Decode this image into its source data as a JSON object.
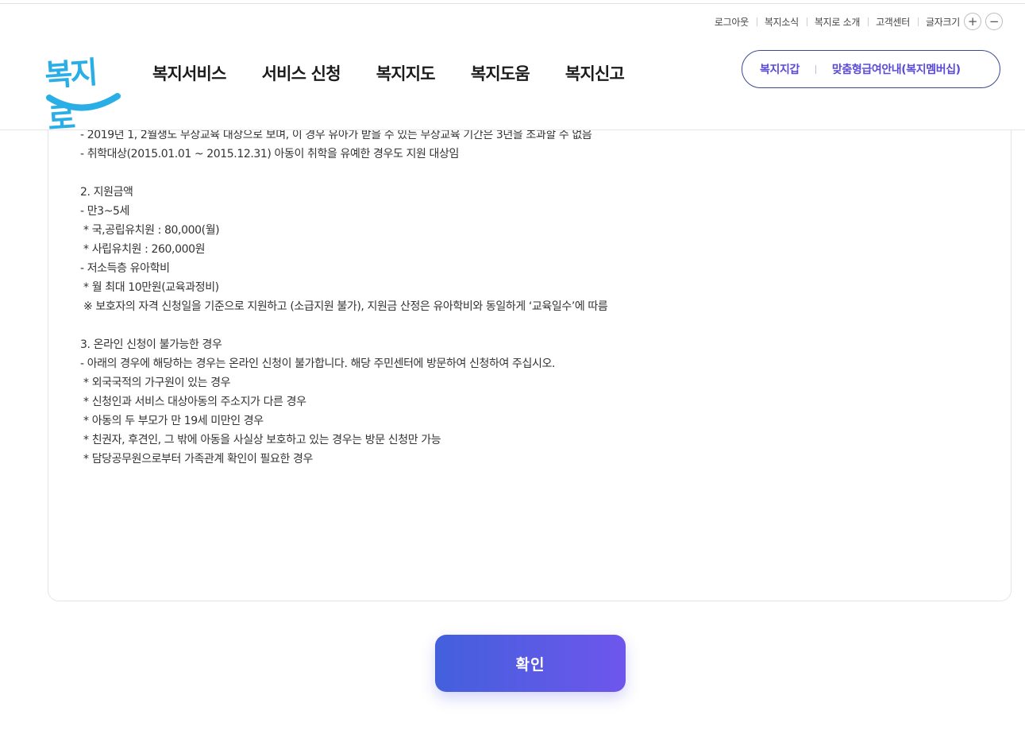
{
  "header": {
    "util_links": [
      "로그아웃",
      "복지소식",
      "복지로 소개",
      "고객센터"
    ],
    "font_size_label": "글자크기",
    "font_increase": "+",
    "font_decrease": "−",
    "logo_text": "복지로",
    "gnb": [
      "복지서비스",
      "서비스 신청",
      "복지지도",
      "복지도움",
      "복지신고"
    ],
    "quick_links": [
      "복지지갑",
      "맞춤형급여안내(복지멤버십)"
    ]
  },
  "content": {
    "lines": [
      "- 2019년 1, 2월생도 무상교육 대상으로 보며, 이 경우 유아가 받을 수 있는 무상교육 기간은 3년을 초과할 수 없음",
      "- 취학대상(2015.01.01 ~ 2015.12.31) 아동이 취학을 유예한 경우도 지원 대상임",
      "",
      "2. 지원금액",
      "- 만3~5세",
      " * 국,공립유치원 : 80,000(월)",
      " * 사립유치원 : 260,000원",
      "- 저소득층 유아학비",
      " * 월 최대 10만원(교육과정비)",
      " ※ 보호자의 자격 신청일을 기준으로 지원하고 (소급지원 불가), 지원금 산정은 유아학비와 동일하게 ‘교육일수’에 따름",
      "",
      "3. 온라인 신청이 불가능한 경우",
      "- 아래의 경우에 해당하는 경우는 온라인 신청이 불가합니다. 해당 주민센터에 방문하여 신청하여 주십시오.",
      " * 외국국적의 가구원이 있는 경우",
      " * 신청인과 서비스 대상아동의 주소지가 다른 경우",
      " * 아동의 두 부모가 만 19세 미만인 경우",
      " * 친권자, 후견인, 그 밖에 아동을 사실상 보호하고 있는 경우는 방문 신청만 가능",
      " * 담당공무원으로부터 가족관계 확인이 필요한 경우"
    ]
  },
  "confirm_label": "확인",
  "colors": {
    "logo": "#2aaee6",
    "pill_text": "#5a4ad6",
    "confirm_start": "#4360dc",
    "confirm_end": "#6e56ec"
  }
}
